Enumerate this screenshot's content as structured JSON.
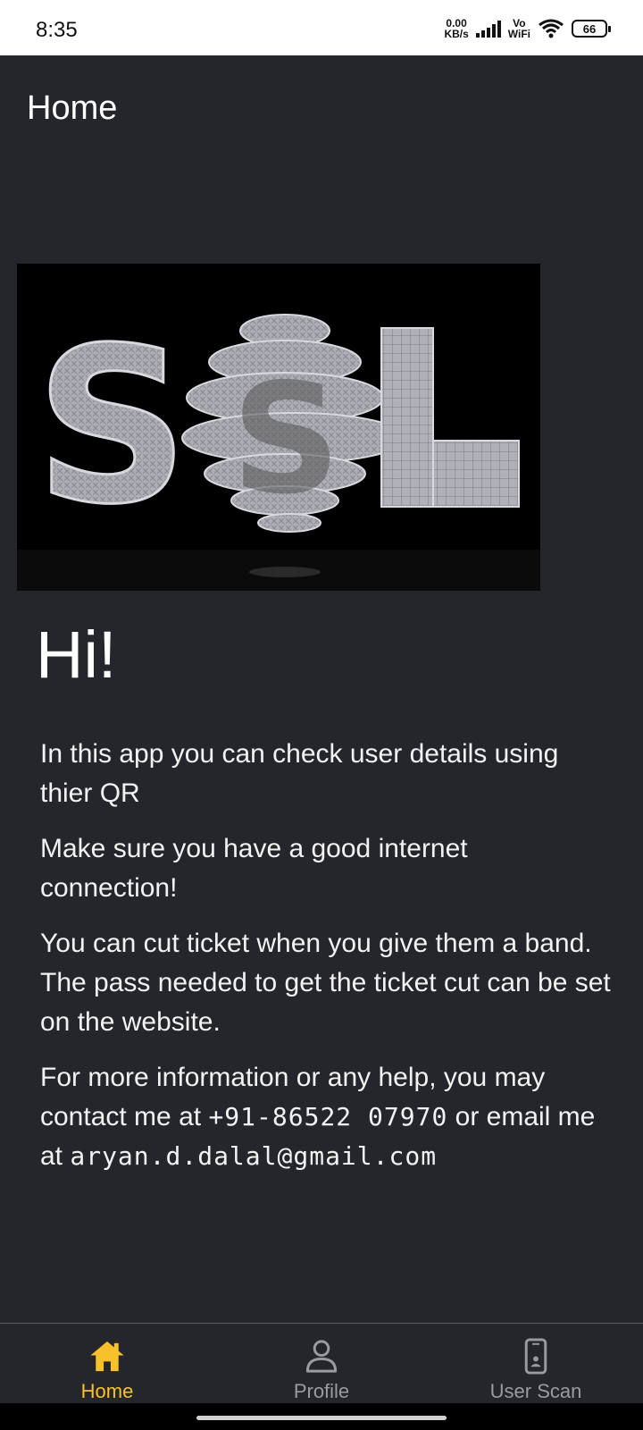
{
  "status_bar": {
    "time": "8:35",
    "net_speed_value": "0.00",
    "net_speed_unit": "KB/s",
    "vo_label": "Vo",
    "wifi_label": "WiFi",
    "battery": "66"
  },
  "app_bar": {
    "title": "Home"
  },
  "logo": {
    "text": "SSL"
  },
  "main": {
    "greeting": "Hi!",
    "paragraphs": {
      "p1": "In this app you can check user details using thier QR",
      "p2": "Make sure you have a good internet connection!",
      "p3": "You can cut ticket when you give them a band. The pass needed to get the ticket cut can be set on the website.",
      "p4_prefix": "For more information or any help, you may contact me at ",
      "phone": "+91-86522 07970",
      "p4_mid": " or email me at ",
      "email": "aryan.d.dalal@gmail.com"
    }
  },
  "bottom_nav": {
    "home": "Home",
    "profile": "Profile",
    "user_scan": "User Scan",
    "active": "home"
  },
  "colors": {
    "background": "#25262b",
    "accent": "#f7c12b",
    "inactive": "#9a9a9f"
  }
}
